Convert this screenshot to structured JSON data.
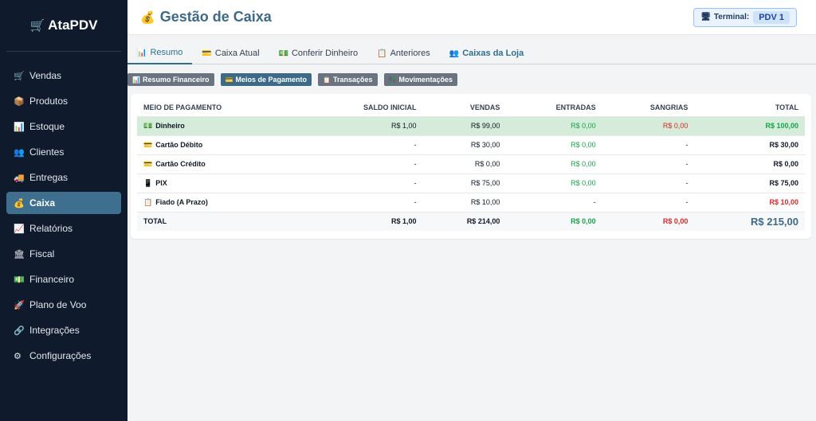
{
  "app": {
    "name": "AtaPDV",
    "brand_icon": "🛒"
  },
  "sidebar": {
    "items": [
      {
        "label": "Vendas",
        "icon": "🛒",
        "active": false
      },
      {
        "label": "Produtos",
        "icon": "📦",
        "active": false
      },
      {
        "label": "Estoque",
        "icon": "📊",
        "active": false
      },
      {
        "label": "Clientes",
        "icon": "👥",
        "active": false
      },
      {
        "label": "Entregas",
        "icon": "🚚",
        "active": false
      },
      {
        "label": "Caixa",
        "icon": "💰",
        "active": true
      },
      {
        "label": "Relatórios",
        "icon": "📈",
        "active": false
      },
      {
        "label": "Fiscal",
        "icon": "🏛",
        "active": false
      },
      {
        "label": "Financeiro",
        "icon": "💵",
        "active": false
      },
      {
        "label": "Plano de Voo",
        "icon": "🚀",
        "active": false
      },
      {
        "label": "Integrações",
        "icon": "🔗",
        "active": false
      },
      {
        "label": "Configurações",
        "icon": "⚙",
        "active": false
      }
    ]
  },
  "header": {
    "title": "Gestão de Caixa",
    "title_icon": "💰",
    "terminal_label": "Terminal:",
    "terminal_icon": "🖥",
    "terminal_value": "PDV 1"
  },
  "tabs": [
    {
      "label": "Resumo",
      "icon": "📊",
      "state": "active"
    },
    {
      "label": "Caixa Atual",
      "icon": "💳",
      "state": ""
    },
    {
      "label": "Conferir Dinheiro",
      "icon": "💵",
      "state": ""
    },
    {
      "label": "Anteriores",
      "icon": "📋",
      "state": ""
    },
    {
      "label": "Caixas da Loja",
      "icon": "👥",
      "state": "highlight"
    }
  ],
  "subtabs": [
    {
      "label": "Resumo Financeiro",
      "icon": "📊",
      "active": false
    },
    {
      "label": "Meios de Pagamento",
      "icon": "💳",
      "active": true
    },
    {
      "label": "Transações",
      "icon": "📋",
      "active": false
    },
    {
      "label": "Movimentações",
      "icon": "💱",
      "active": false
    }
  ],
  "table": {
    "columns": [
      "MEIO DE PAGAMENTO",
      "SALDO INICIAL",
      "VENDAS",
      "ENTRADAS",
      "SANGRIAS",
      "TOTAL"
    ],
    "rows": [
      {
        "icon": "💵",
        "name": "Dinheiro",
        "saldo": "R$ 1,00",
        "vendas": "R$ 99,00",
        "entradas": "R$ 0,00",
        "sangrias": "R$ 0,00",
        "total": "R$ 100,00",
        "highlight": true,
        "total_color": "green"
      },
      {
        "icon": "💳",
        "name": "Cartão Débito",
        "saldo": "-",
        "vendas": "R$ 30,00",
        "entradas": "R$ 0,00",
        "sangrias": "-",
        "total": "R$ 30,00",
        "highlight": false,
        "total_color": ""
      },
      {
        "icon": "💳",
        "name": "Cartão Crédito",
        "saldo": "-",
        "vendas": "R$ 0,00",
        "entradas": "R$ 0,00",
        "sangrias": "-",
        "total": "R$ 0,00",
        "highlight": false,
        "total_color": ""
      },
      {
        "icon": "📱",
        "name": "PIX",
        "saldo": "-",
        "vendas": "R$ 75,00",
        "entradas": "R$ 0,00",
        "sangrias": "-",
        "total": "R$ 75,00",
        "highlight": false,
        "total_color": ""
      },
      {
        "icon": "📋",
        "name": "Fiado (A Prazo)",
        "saldo": "-",
        "vendas": "R$ 10,00",
        "entradas": "-",
        "sangrias": "-",
        "total": "R$ 10,00",
        "highlight": false,
        "total_color": "red"
      }
    ],
    "totals": {
      "label": "TOTAL",
      "saldo": "R$ 1,00",
      "vendas": "R$ 214,00",
      "entradas": "R$ 0,00",
      "sangrias": "R$ 0,00",
      "total": "R$ 215,00"
    }
  },
  "colors": {
    "accent": "#3d6a88",
    "sidebar_bg": "#0f1b2d",
    "green": "#16a34a",
    "red": "#dc2626",
    "highlight_row": "#d4ecd9"
  }
}
